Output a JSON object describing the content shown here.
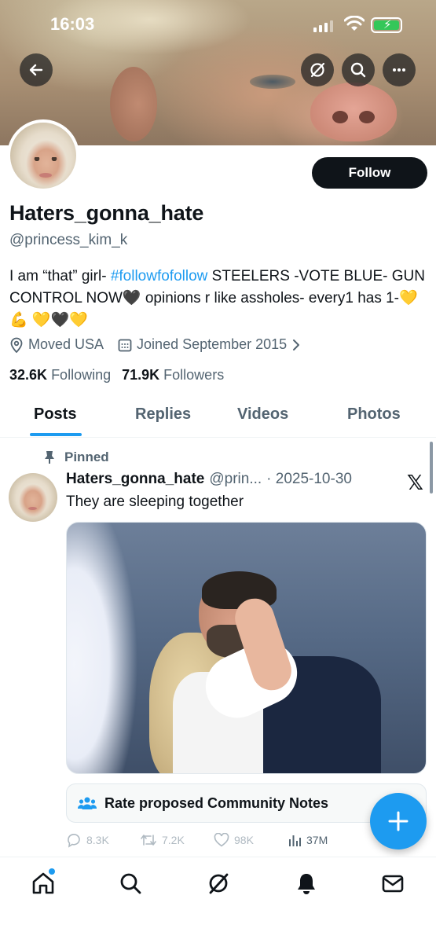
{
  "status_bar": {
    "time": "16:03"
  },
  "header": {
    "back_icon": "arrow-left-icon",
    "grok_icon": "grok-icon",
    "search_icon": "search-icon",
    "more_icon": "more-icon"
  },
  "profile": {
    "follow_label": "Follow",
    "name": "Haters_gonna_hate",
    "handle": "@princess_kim_k",
    "bio_part1": "I am “that” girl- ",
    "bio_hashtag": "#followfofollow",
    "bio_part2": " STEELERS -VOTE BLUE- GUN CONTROL NOW🖤 opinions r like assholes- every1 has 1-💛 💪 💛🖤💛",
    "location": "Moved USA",
    "joined": "Joined September 2015",
    "following_count": "32.6K",
    "following_label": "Following",
    "followers_count": "71.9K",
    "followers_label": "Followers"
  },
  "tabs": [
    "Posts",
    "Replies",
    "Videos",
    "Photos"
  ],
  "pinned_tweet": {
    "pinned_label": "Pinned",
    "name": "Haters_gonna_hate",
    "handle": "@prin...",
    "date": "· 2025-10-30",
    "text": "They are sleeping together",
    "community_notes_label": "Rate proposed Community Notes",
    "replies": "8.3K",
    "reposts": "7.2K",
    "likes": "98K",
    "views": "37M"
  },
  "colors": {
    "accent": "#1d9bf0",
    "text": "#0f1419",
    "secondary": "#536471"
  }
}
